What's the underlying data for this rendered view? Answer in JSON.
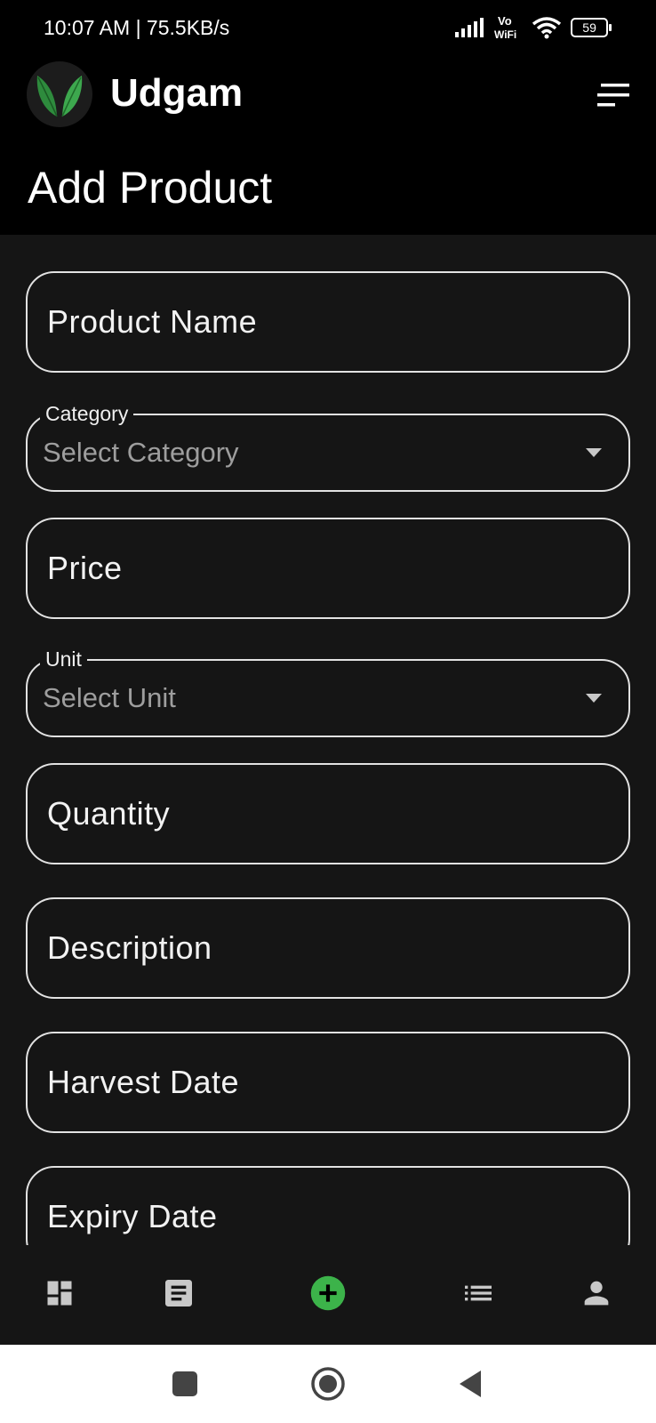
{
  "status_bar": {
    "time_speed": "10:07 AM | 75.5KB/s",
    "vowifi": [
      "Vo",
      "WiFi"
    ],
    "battery": "59"
  },
  "app": {
    "name": "Udgam"
  },
  "page": {
    "title": "Add Product"
  },
  "form": {
    "product_name": {
      "placeholder": "Product Name"
    },
    "category": {
      "label": "Category",
      "value": "Select Category"
    },
    "price": {
      "placeholder": "Price"
    },
    "unit": {
      "label": "Unit",
      "value": "Select Unit"
    },
    "quantity": {
      "placeholder": "Quantity"
    },
    "description": {
      "placeholder": "Description"
    },
    "harvest_date": {
      "placeholder": "Harvest Date"
    },
    "expiry_date": {
      "placeholder": "Expiry Date"
    }
  },
  "bottom_nav": [
    {
      "icon": "dashboard-icon"
    },
    {
      "icon": "article-icon"
    },
    {
      "icon": "add-circle-icon",
      "active": true
    },
    {
      "icon": "list-icon"
    },
    {
      "icon": "person-icon"
    }
  ],
  "colors": {
    "accent": "#3cb34a",
    "background": "#151515",
    "appbar": "#000000",
    "border": "#e2e2e2",
    "icon": "#c8c8c8"
  }
}
